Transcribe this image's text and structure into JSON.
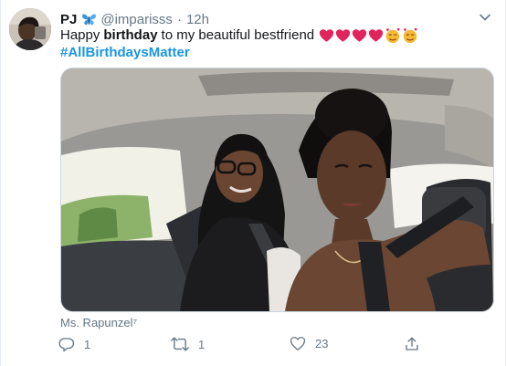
{
  "tweet": {
    "display_name": "PJ",
    "handle": "@imparisss",
    "separator": "·",
    "time": "12h",
    "text": {
      "before": "Happy",
      "bold": "birthday",
      "after": "to my beautiful bestfriend",
      "emojis": [
        "heart-emoji",
        "heart-emoji",
        "heart-emoji",
        "heart-emoji",
        "smiling-face-with-hearts-emoji",
        "smiling-face-with-hearts-emoji"
      ],
      "hashtag": "#AllBirthdaysMatter"
    },
    "media": {
      "subject": "selfie-photo-in-car"
    },
    "media_credit": "Ms. Rapunzel⁷",
    "actions": {
      "reply_count": "1",
      "retweet_count": "1",
      "like_count": "23"
    },
    "icons": {
      "verified_emoji": "butterfly-icon",
      "menu": "chevron-down-icon",
      "reply": "reply-icon",
      "retweet": "retweet-icon",
      "like": "heart-icon",
      "share": "share-icon"
    },
    "colors": {
      "link": "#1b95e0",
      "muted": "#657786",
      "text": "#14171a",
      "heart_emoji": "#e0245e"
    }
  }
}
